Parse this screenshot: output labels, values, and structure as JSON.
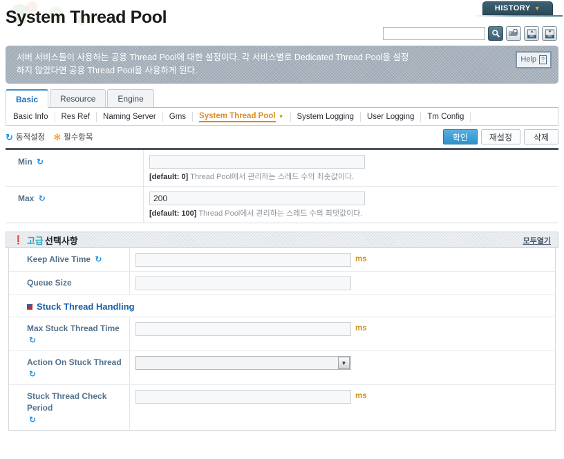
{
  "header": {
    "title": "System Thread Pool",
    "history_label": "HISTORY",
    "history_caret": "▼",
    "search_value": "",
    "search_placeholder": "",
    "tools": [
      {
        "name": "search-icon",
        "glyph": "🔍"
      },
      {
        "name": "import-icon",
        "glyph": "↺"
      },
      {
        "name": "xml-upload-icon",
        "glyph": "XML"
      },
      {
        "name": "xml-download-icon",
        "glyph": "XML"
      }
    ]
  },
  "description": {
    "line1": "서버 서비스들이 사용하는 공용 Thread Pool에 대한 설정이다. 각 서비스별로 Dedicated Thread Pool을 설정",
    "line2": "하지 않았다면 공용 Thread Pool을 사용하게 된다.",
    "help_label": "Help",
    "help_mark": "?"
  },
  "tabs": [
    {
      "label": "Basic",
      "active": true
    },
    {
      "label": "Resource",
      "active": false
    },
    {
      "label": "Engine",
      "active": false
    }
  ],
  "submenu": [
    {
      "label": "Basic Info",
      "active": false
    },
    {
      "label": "Res Ref",
      "active": false
    },
    {
      "label": "Naming Server",
      "active": false
    },
    {
      "label": "Gms",
      "active": false
    },
    {
      "label": "System Thread Pool",
      "active": true
    },
    {
      "label": "System Logging",
      "active": false
    },
    {
      "label": "User Logging",
      "active": false
    },
    {
      "label": "Tm Config",
      "active": false
    }
  ],
  "legend": {
    "dynamic_icon": "↺",
    "dynamic_label": "동적설정",
    "required_icon": "✻",
    "required_label": "필수항목"
  },
  "actions": {
    "confirm": "확인",
    "reset": "재설정",
    "delete": "삭제"
  },
  "basic_fields": [
    {
      "label": "Min",
      "dynamic": true,
      "value": "",
      "hint_default": "[default: 0]",
      "hint_text": "Thread Pool에서 관리하는 스레드 수의 최솟값이다."
    },
    {
      "label": "Max",
      "dynamic": true,
      "value": "200",
      "hint_default": "[default: 100]",
      "hint_text": "Thread Pool에서 관리하는 스레드 수의 최댓값이다."
    }
  ],
  "advanced": {
    "pin_icon": "❗",
    "title_highlight": "고급",
    "title_rest": "선택사항",
    "open_all": "모두열기",
    "fields_top": [
      {
        "label": "Keep Alive Time",
        "dynamic": true,
        "value": "",
        "unit": "ms",
        "type": "text"
      },
      {
        "label": "Queue Size",
        "dynamic": false,
        "value": "",
        "unit": "",
        "type": "text"
      }
    ],
    "subsection": {
      "title": "Stuck Thread Handling",
      "fields": [
        {
          "label": "Max Stuck Thread Time",
          "dynamic": true,
          "value": "",
          "unit": "ms",
          "type": "text"
        },
        {
          "label": "Action On Stuck Thread",
          "dynamic": true,
          "value": "",
          "unit": "",
          "type": "select",
          "arrow": "▼"
        },
        {
          "label": "Stuck Thread Check Period",
          "dynamic": true,
          "value": "",
          "unit": "ms",
          "type": "text"
        }
      ]
    }
  }
}
